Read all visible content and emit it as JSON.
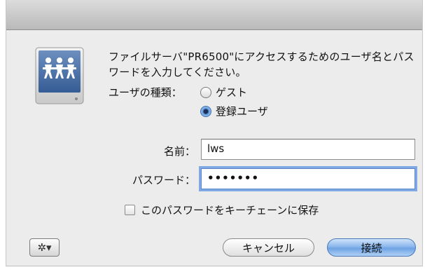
{
  "dialog": {
    "message": "ファイルサーバ\"PR6500\"にアクセスするためのユーザ名とパスワードを入力してください。",
    "user_type_label": "ユーザの種類：",
    "user_type_options": [
      {
        "label": "ゲスト",
        "selected": false
      },
      {
        "label": "登録ユーザ",
        "selected": true
      }
    ],
    "name_label": "名前：",
    "name_value": "lws",
    "password_label": "パスワード：",
    "password_value": "•••••••",
    "remember_label": "このパスワードをキーチェーンに保存",
    "remember_checked": false,
    "gear_button_label": "✲▾",
    "cancel_label": "キャンセル",
    "connect_label": "接続"
  },
  "colors": {
    "dialog_bg": "#ececec",
    "default_button": "#8ab7ec",
    "focus_ring": "#7fa9e4"
  },
  "icons": {
    "server": "network-drive-icon",
    "gear": "gear-icon"
  }
}
